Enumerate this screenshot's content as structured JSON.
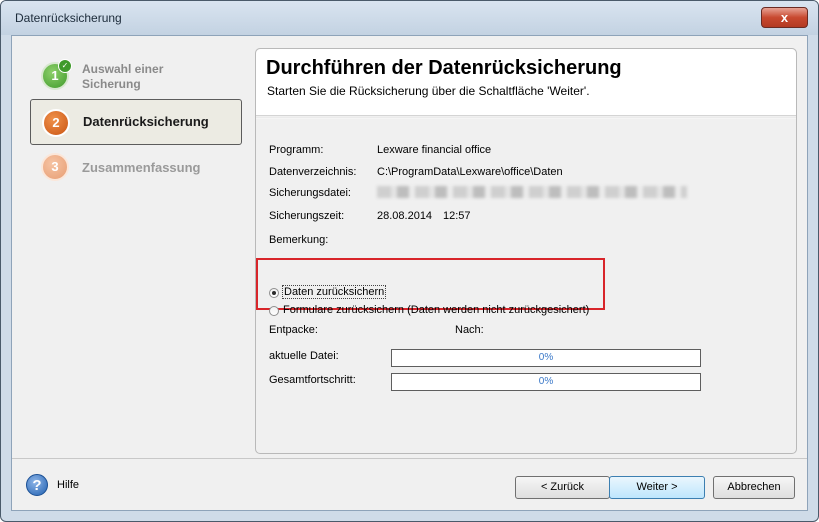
{
  "window": {
    "title": "Datenrücksicherung",
    "close_glyph": "x"
  },
  "steps": [
    {
      "number": "1",
      "label_line1": "Auswahl einer",
      "label_line2": "Sicherung",
      "state": "done"
    },
    {
      "number": "2",
      "label": "Datenrücksicherung",
      "state": "active"
    },
    {
      "number": "3",
      "label": "Zusammenfassung",
      "state": "pending"
    }
  ],
  "panel": {
    "title": "Durchführen der Datenrücksicherung",
    "subtitle": "Starten Sie die Rücksicherung über die Schaltfläche 'Weiter'."
  },
  "info": {
    "program_label": "Programm:",
    "program_value": "Lexware financial office",
    "dir_label": "Datenverzeichnis:",
    "dir_value": "C:\\ProgramData\\Lexware\\office\\Daten",
    "file_label": "Sicherungsdatei:",
    "time_label": "Sicherungszeit:",
    "time_date": "28.08.2014",
    "time_clock": "12:57",
    "remark_label": "Bemerkung:"
  },
  "options": {
    "restore_data": "Daten zurücksichern",
    "restore_forms": "Formulare zurücksichern (Daten werden nicht zurückgesichert)",
    "selected": "restore_data"
  },
  "progress": {
    "unpack_label": "Entpacke:",
    "to_label": "Nach:",
    "current_label": "aktuelle Datei:",
    "current_value": "0%",
    "total_label": "Gesamtfortschritt:",
    "total_value": "0%"
  },
  "footer": {
    "help": "Hilfe",
    "back": "< Zurück",
    "next": "Weiter >",
    "cancel": "Abbrechen"
  },
  "colors": {
    "highlight_border": "#d8252a",
    "progress_text": "#3a78c8"
  }
}
